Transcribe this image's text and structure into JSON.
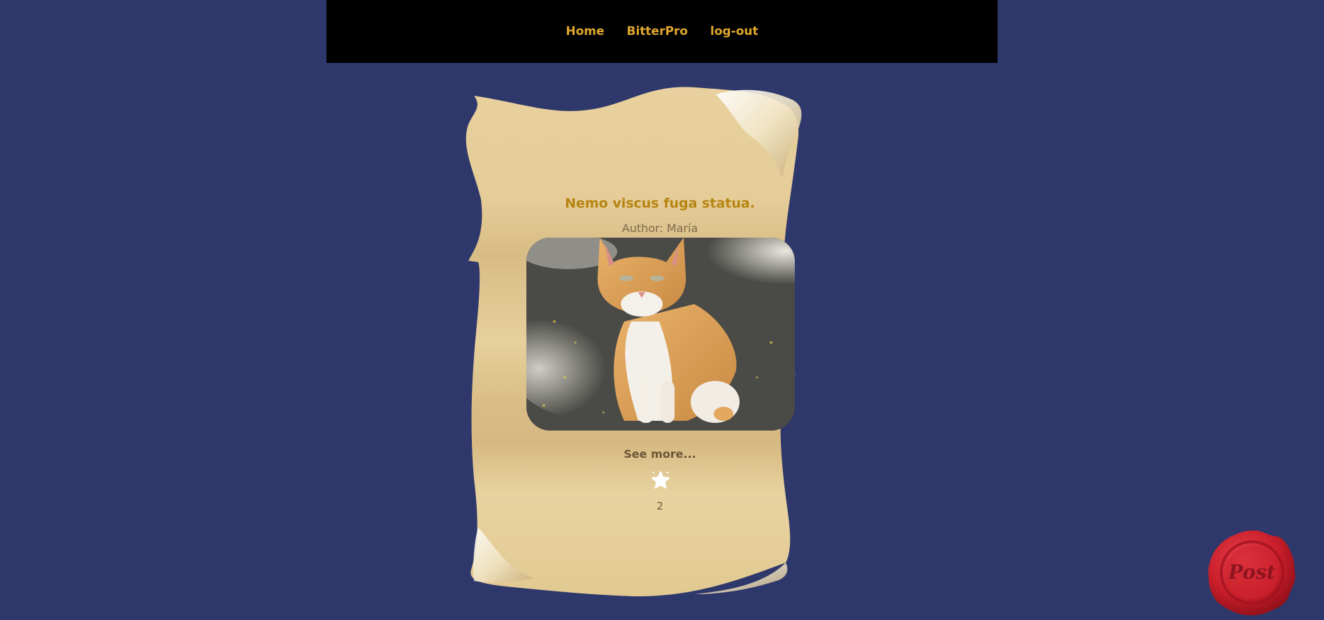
{
  "nav": {
    "items": [
      {
        "label": "Home"
      },
      {
        "label": "BitterPro"
      },
      {
        "label": "log-out"
      }
    ]
  },
  "post": {
    "title": "Nemo viscus fuga statua.",
    "author": "Author: María",
    "image_alt": "orange and white cat",
    "see_more": "See more...",
    "likes": "2"
  },
  "post_button": {
    "label": "Post"
  },
  "colors": {
    "background": "#2f386b",
    "nav_bg": "#000000",
    "nav_link": "#e0a72e",
    "parchment": "#e6cf9b",
    "title": "#b68410",
    "seal": "#c81e2a"
  },
  "icons": {
    "like": "star-icon",
    "post": "wax-seal-icon"
  }
}
